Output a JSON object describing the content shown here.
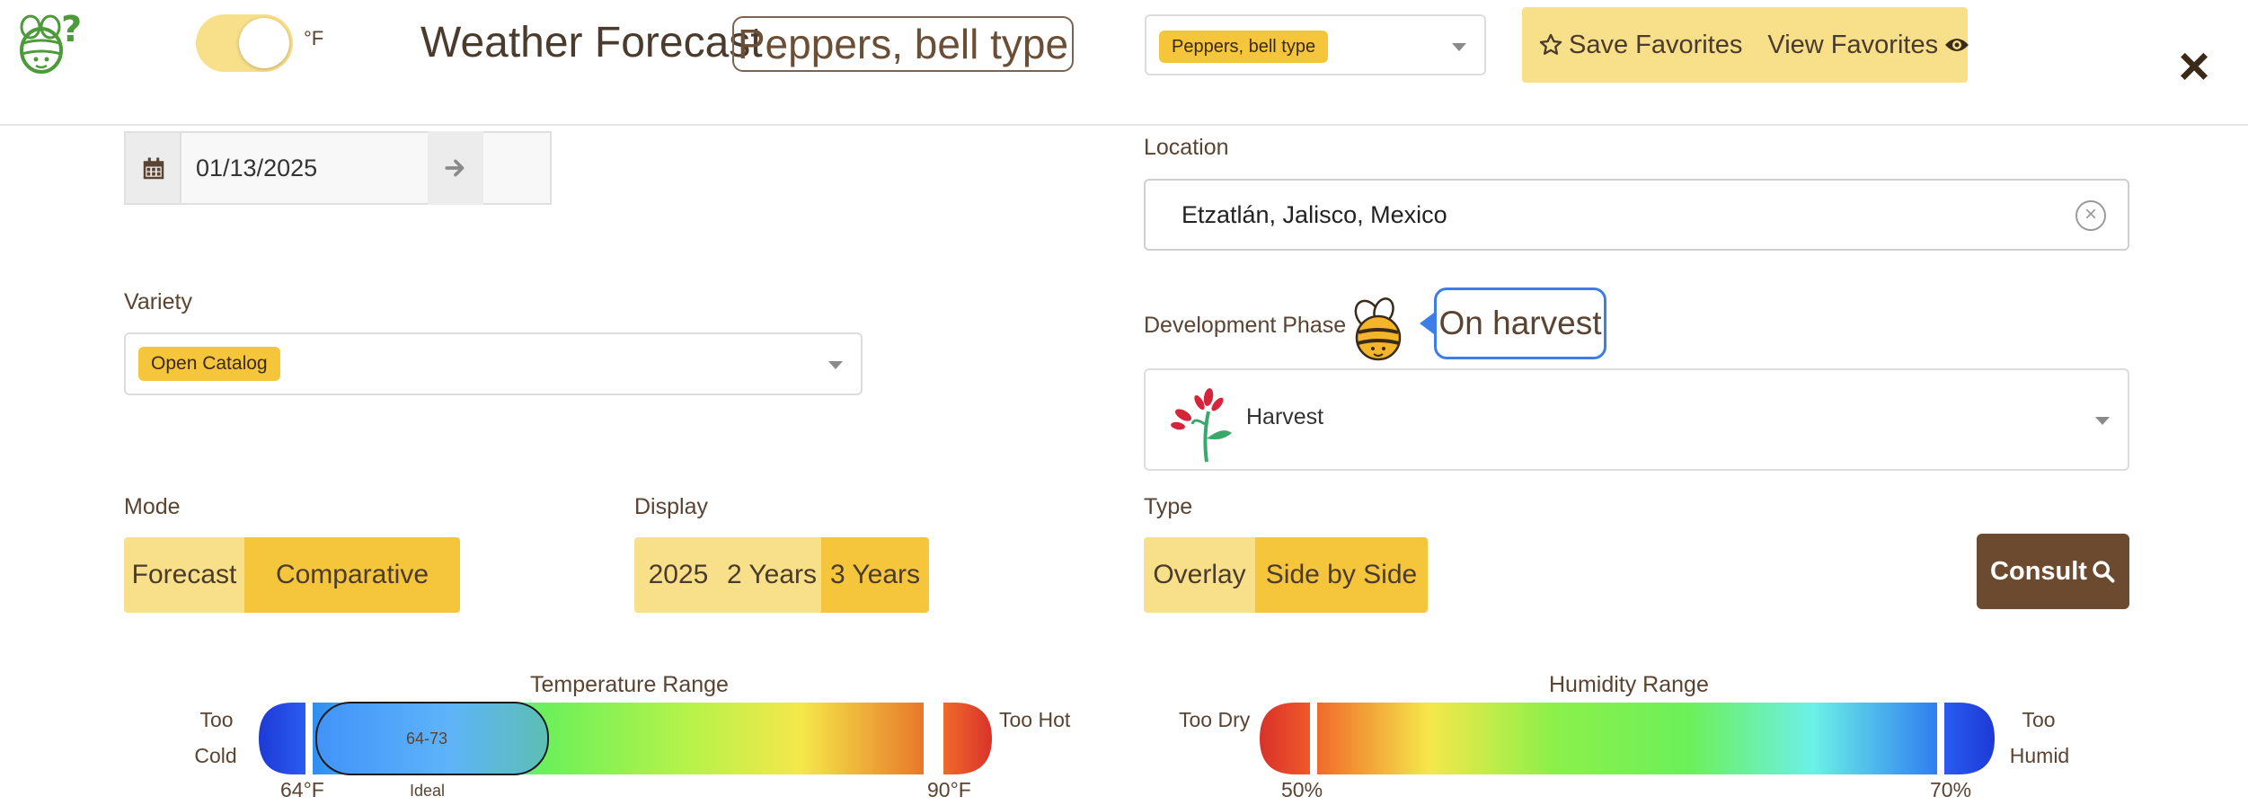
{
  "header": {
    "unit_label": "°F",
    "title": "Weather Forecast",
    "crop_title": "Peppers, bell type",
    "crop_select_value": "Peppers, bell type",
    "save_favorites": "Save Favorites",
    "view_favorites": "View Favorites",
    "close_icon": "×"
  },
  "date": {
    "value": "01/13/2025"
  },
  "location": {
    "label": "Location",
    "value": "Etzatlán, Jalisco, Mexico"
  },
  "variety": {
    "label": "Variety",
    "value": "Open Catalog"
  },
  "phase": {
    "label": "Development Phase",
    "bubble": "On harvest",
    "value": "Harvest"
  },
  "mode": {
    "label": "Mode",
    "options": [
      "Forecast",
      "Comparative"
    ],
    "selected": "Comparative"
  },
  "display": {
    "label": "Display",
    "options": [
      "2025",
      "2 Years",
      "3 Years"
    ],
    "selected": "3 Years"
  },
  "type": {
    "label": "Type",
    "options": [
      "Overlay",
      "Side by Side"
    ],
    "selected": "Side by Side"
  },
  "consult": {
    "label": "Consult"
  },
  "temperature_range": {
    "title": "Temperature Range",
    "too_cold": [
      "Too",
      "Cold"
    ],
    "too_hot": "Too Hot",
    "min_label": "64°F",
    "max_label": "90°F",
    "ideal_range": "64-73",
    "ideal_label": "Ideal"
  },
  "humidity_range": {
    "title": "Humidity Range",
    "too_dry": "Too Dry",
    "too_humid": [
      "Too",
      "Humid"
    ],
    "min_label": "50%",
    "max_label": "70%"
  },
  "colors": {
    "accent_light": "#f8df8a",
    "accent": "#f5c53c",
    "brand_brown": "#6b4a2f",
    "bubble_border": "#3d7de8"
  }
}
